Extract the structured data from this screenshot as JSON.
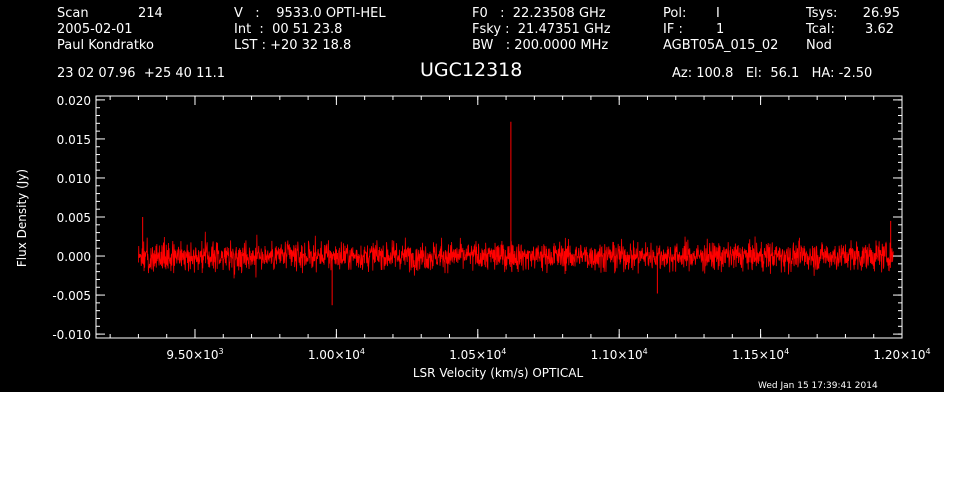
{
  "header": {
    "scan_label": "Scan",
    "scan_value": "214",
    "date": "2005-02-01",
    "observer": "Paul Kondratko",
    "v_line": "V   :    9533.0 OPTI-HEL",
    "int_line": "Int  :  00 51 23.8",
    "lst_line": "LST : +20 32 18.8",
    "f0_line": "F0   :  22.23508 GHz",
    "fsky_line": "Fsky :  21.47351 GHz",
    "bw_line": "BW   : 200.0000 MHz",
    "pol_label": "Pol:",
    "pol_value": "I",
    "if_label": "IF :",
    "if_value": "1",
    "project": "AGBT05A_015_02",
    "tsys_label": "Tsys:",
    "tsys_value": "26.95",
    "tcal_label": "Tcal:",
    "tcal_value": "3.62",
    "mode": "Nod",
    "coords": "23 02 07.96  +25 40 11.1",
    "object": "UGC12318",
    "pointing": "Az: 100.8   El:  56.1   HA: -2.50",
    "timestamp": "Wed Jan 15 17:39:41 2014"
  },
  "chart_data": {
    "type": "line",
    "xlabel": "LSR Velocity (km/s) OPTICAL",
    "ylabel": "Flux Density (Jy)",
    "xlim": [
      9150,
      12000
    ],
    "ylim": [
      -0.0105,
      0.0205
    ],
    "xticks": [
      {
        "value": 9500,
        "mant": "9.50",
        "exp": "3"
      },
      {
        "value": 10000,
        "mant": "1.00",
        "exp": "4"
      },
      {
        "value": 10500,
        "mant": "1.05",
        "exp": "4"
      },
      {
        "value": 11000,
        "mant": "1.10",
        "exp": "4"
      },
      {
        "value": 11500,
        "mant": "1.15",
        "exp": "4"
      },
      {
        "value": 12000,
        "mant": "1.20",
        "exp": "4"
      }
    ],
    "yticks": [
      {
        "value": -0.01,
        "label": "-0.010"
      },
      {
        "value": -0.005,
        "label": "-0.005"
      },
      {
        "value": 0.0,
        "label": "0.000"
      },
      {
        "value": 0.005,
        "label": "0.005"
      },
      {
        "value": 0.01,
        "label": "0.010"
      },
      {
        "value": 0.015,
        "label": "0.015"
      },
      {
        "value": 0.02,
        "label": "0.020"
      }
    ],
    "series": [
      {
        "color": "#ff0000",
        "x_range": [
          9300,
          11970
        ],
        "noise_rms": 0.0013,
        "spikes": [
          {
            "x": 10617,
            "y": 0.0172
          },
          {
            "x": 9985,
            "y": -0.0063
          },
          {
            "x": 11135,
            "y": -0.0048
          },
          {
            "x": 9315,
            "y": 0.005
          },
          {
            "x": 11960,
            "y": 0.0045
          }
        ]
      }
    ]
  }
}
